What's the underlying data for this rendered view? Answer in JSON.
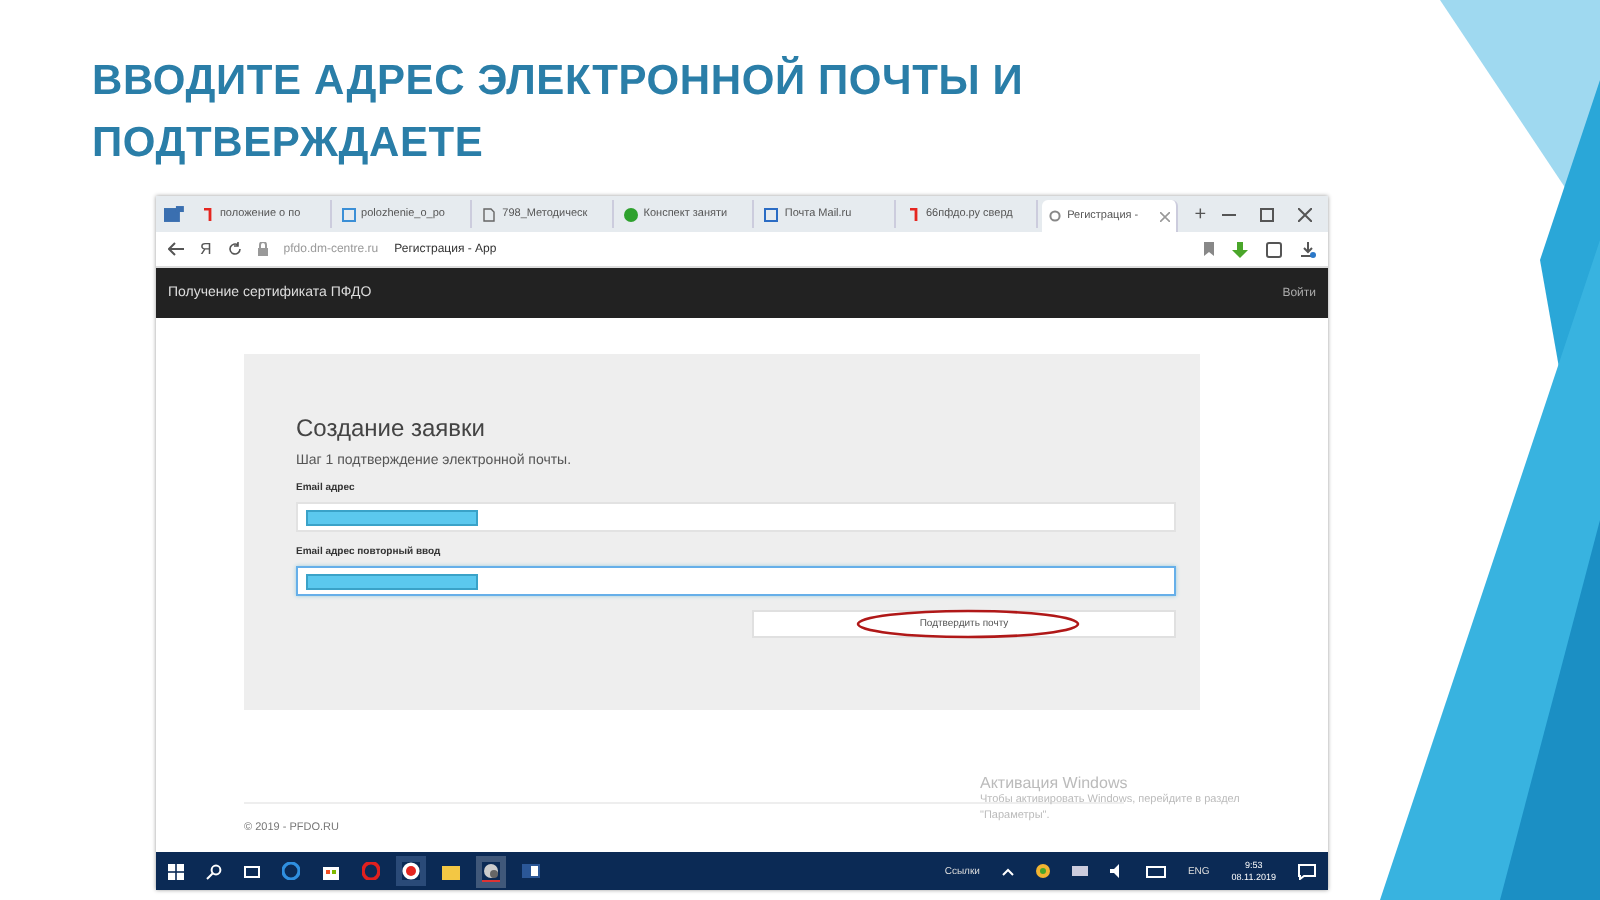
{
  "title": "ВВОДИТЕ АДРЕС ЭЛЕКТРОННОЙ ПОЧТЫ И ПОДТВЕРЖДАЕТЕ",
  "browser": {
    "tabs": [
      {
        "label": "положение о по",
        "kind": "yandex",
        "selected": false
      },
      {
        "label": "polozhenie_o_po",
        "kind": "doc",
        "selected": false
      },
      {
        "label": "798_Методическ",
        "kind": "file",
        "selected": false
      },
      {
        "label": "Конспект заняти",
        "kind": "check",
        "selected": false
      },
      {
        "label": "Почта Mail.ru",
        "kind": "mail",
        "selected": false
      },
      {
        "label": "66пфдо.ру сверд",
        "kind": "yandex",
        "selected": false
      },
      {
        "label": "Регистрация -",
        "kind": "pin",
        "selected": true
      }
    ],
    "new_tab": "+",
    "home": "Я",
    "url": "pfdo.dm-centre.ru",
    "page_title": "Регистрация - App"
  },
  "site_header": {
    "brand": "Получение сертификата ПФДО",
    "login": "Войти"
  },
  "form": {
    "heading": "Создание заявки",
    "step": "Шаг 1 подтверждение электронной почты.",
    "fields": [
      {
        "label": "Email адрес",
        "focused": false
      },
      {
        "label": "Email адрес повторный ввод",
        "focused": true
      }
    ],
    "button": "Подтвердить почту"
  },
  "footer": "© 2019 - PFDO.RU",
  "activation": {
    "title": "Активация Windows",
    "text": "Чтобы активировать Windows, перейдите в раздел \"Параметры\"."
  },
  "taskbar": {
    "links": "Ссылки",
    "lang": "ENG",
    "time": "9:53",
    "date": "08.11.2019"
  }
}
